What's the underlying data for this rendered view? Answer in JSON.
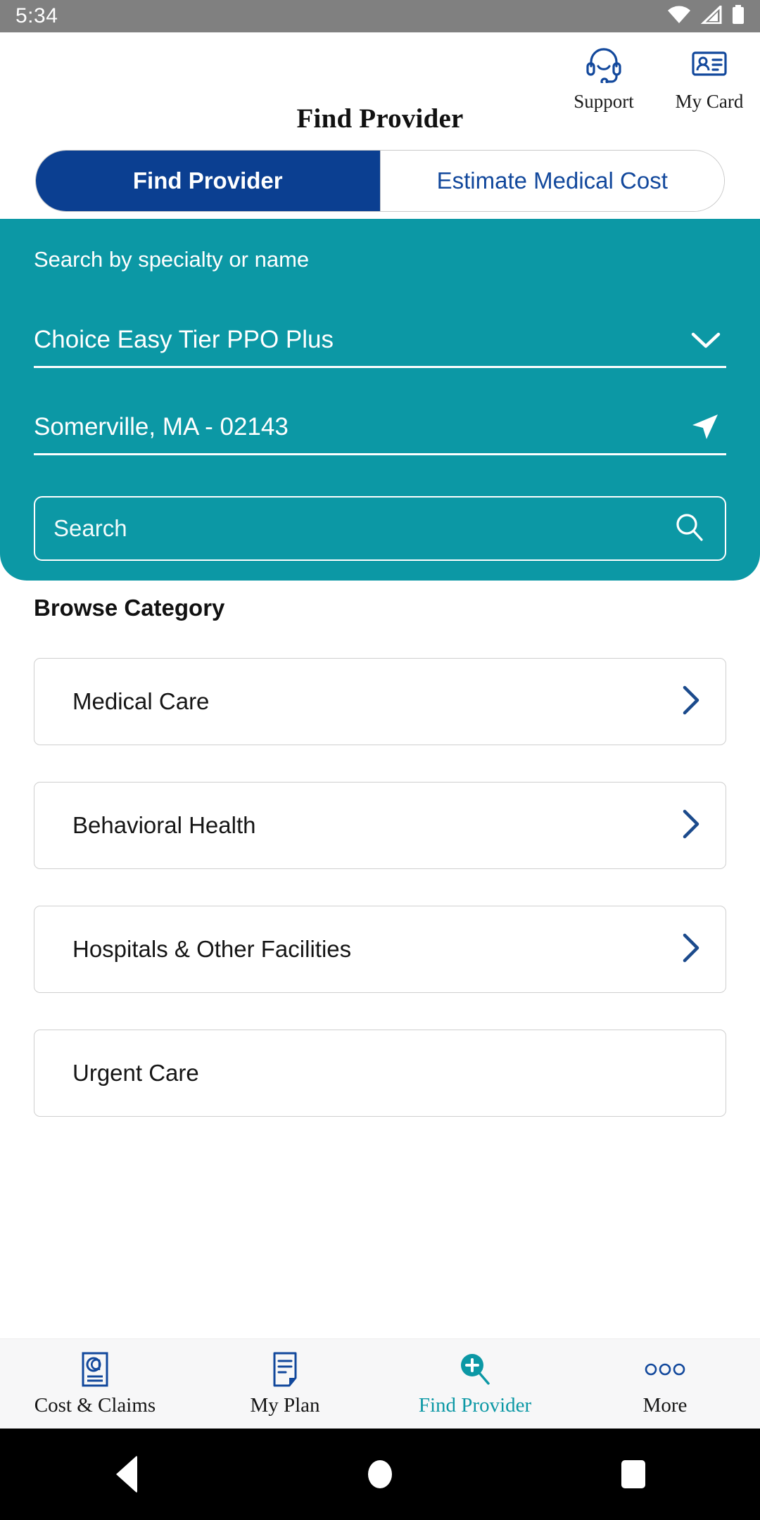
{
  "status_bar": {
    "time": "5:34",
    "icons": [
      "wifi-icon",
      "cellular-signal-icon",
      "battery-icon"
    ]
  },
  "header": {
    "title": "Find Provider",
    "actions": [
      {
        "label": "Support",
        "icon": "headset-support-icon"
      },
      {
        "label": "My Card",
        "icon": "id-card-icon"
      }
    ]
  },
  "segmented_control": {
    "active_index": 0,
    "options": [
      {
        "label": "Find Provider",
        "active": true
      },
      {
        "label": "Estimate Medical Cost",
        "active": false
      }
    ]
  },
  "search_panel": {
    "caption": "Search by specialty or name",
    "plan_field": {
      "value": "Choice Easy Tier PPO Plus",
      "icon": "chevron-down-icon"
    },
    "location_field": {
      "value": "Somerville, MA - 02143",
      "icon": "current-location-icon"
    },
    "search_input": {
      "placeholder": "Search",
      "value": "",
      "icon": "search-icon"
    }
  },
  "browse": {
    "title": "Browse Category",
    "categories": [
      {
        "label": "Medical Care",
        "chevron": true
      },
      {
        "label": "Behavioral Health",
        "chevron": true
      },
      {
        "label": "Hospitals & Other Facilities",
        "chevron": true
      },
      {
        "label": "Urgent Care",
        "chevron": false
      }
    ]
  },
  "bottom_nav": {
    "items": [
      {
        "label": "Cost & Claims",
        "icon": "cost-claims-icon",
        "active": false
      },
      {
        "label": "My Plan",
        "icon": "my-plan-document-icon",
        "active": false
      },
      {
        "label": "Find Provider",
        "icon": "search-plus-icon",
        "active": true
      },
      {
        "label": "More",
        "icon": "more-dots-icon",
        "active": false
      }
    ]
  },
  "system_nav": {
    "back": "back-button",
    "home": "home-button",
    "recents": "recents-button"
  },
  "colors": {
    "status_bar": "#808080",
    "teal": "#0C98A5",
    "navy": "#0B3F91",
    "chevron_blue": "#1B4A8C",
    "nav_bg": "#F7F7F8"
  }
}
